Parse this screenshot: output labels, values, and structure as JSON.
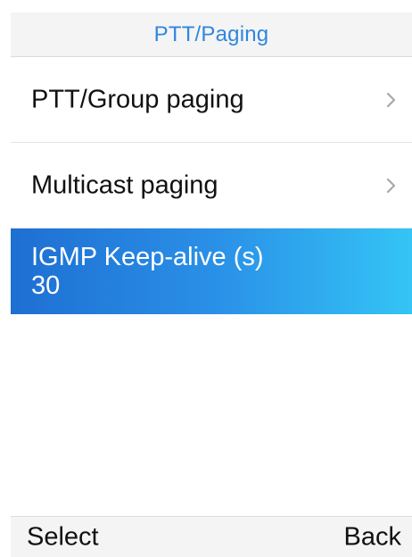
{
  "header": {
    "title": "PTT/Paging"
  },
  "menu": {
    "items": [
      {
        "label": "PTT/Group paging",
        "icon": "chevron-right-icon"
      },
      {
        "label": "Multicast paging",
        "icon": "chevron-right-icon"
      }
    ],
    "selected": {
      "title": "IGMP Keep-alive (s)",
      "value": "30"
    }
  },
  "softkeys": {
    "left": "Select",
    "right": "Back"
  },
  "colors": {
    "accent": "#2f86e0",
    "selection_start": "#1e6fd2",
    "selection_end": "#34c4f5",
    "background": "#ffffff",
    "bar_background": "#f4f4f4"
  }
}
